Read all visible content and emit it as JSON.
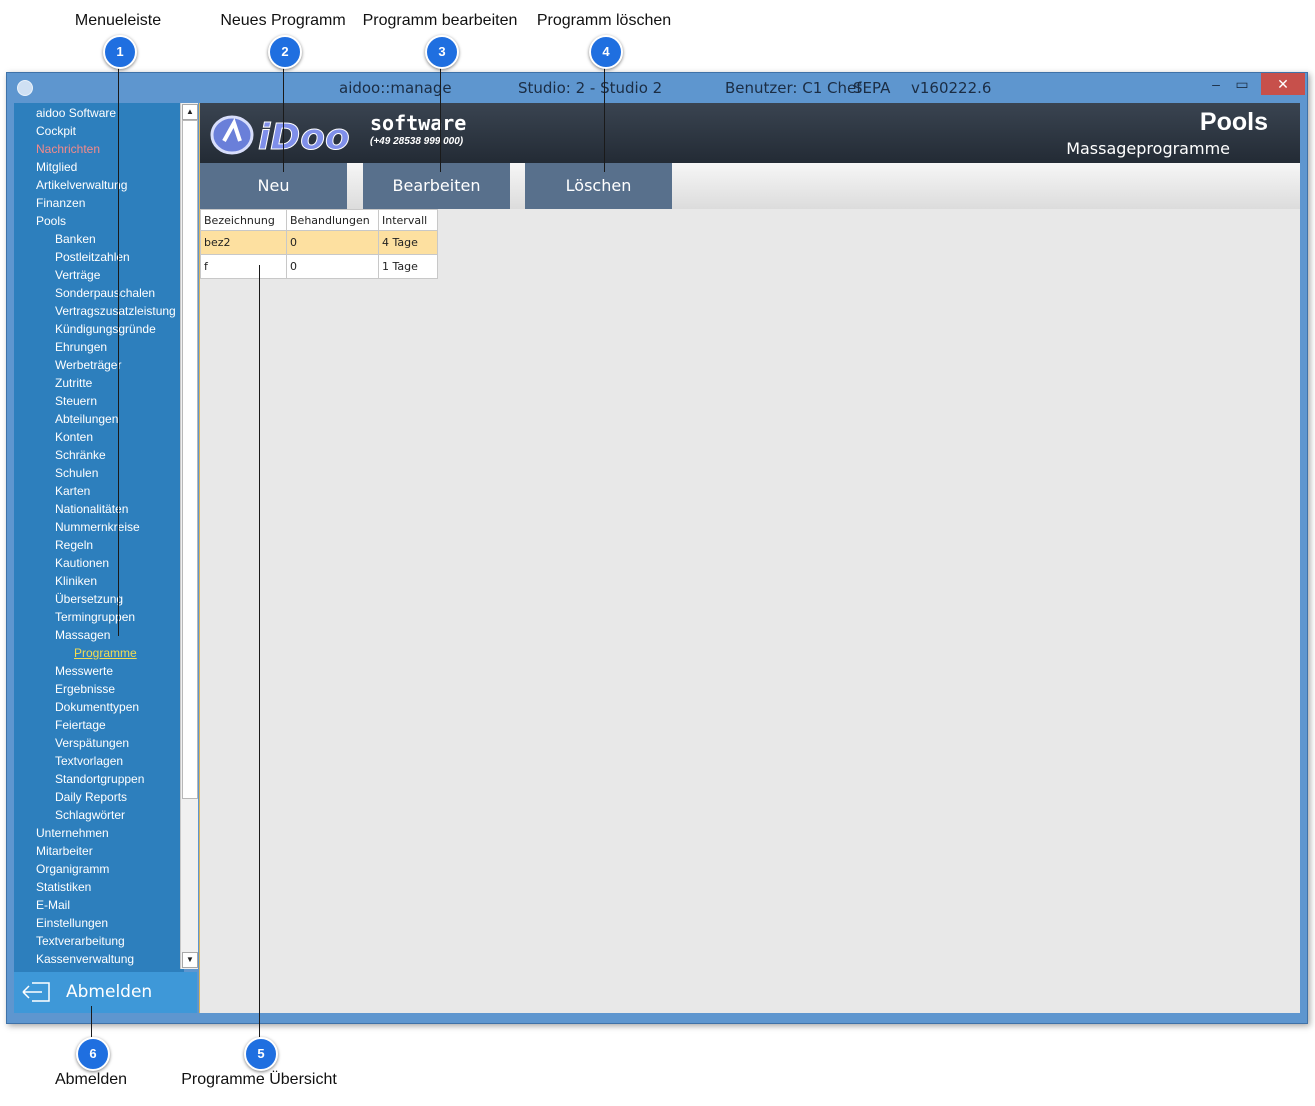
{
  "callouts": [
    {
      "num": "1",
      "label": "Menueleiste"
    },
    {
      "num": "2",
      "label": "Neues Programm"
    },
    {
      "num": "3",
      "label": "Programm bearbeiten"
    },
    {
      "num": "4",
      "label": "Programm löschen"
    },
    {
      "num": "5",
      "label": "Programme Übersicht"
    },
    {
      "num": "6",
      "label": "Abmelden"
    }
  ],
  "titlebar": {
    "app": "aidoo::manage",
    "studio": "Studio: 2 - Studio 2",
    "user": "Benutzer: C1 Chef",
    "sepa": "SEPA",
    "version": "v160222.6",
    "minimize": "–",
    "maximize": "▭",
    "close": "✕"
  },
  "menu": {
    "items": [
      {
        "label": "aidoo Software",
        "level": 0
      },
      {
        "label": "Cockpit",
        "level": 0
      },
      {
        "label": "Nachrichten",
        "level": 0,
        "state": "red"
      },
      {
        "label": "Mitglied",
        "level": 0
      },
      {
        "label": "Artikelverwaltung",
        "level": 0
      },
      {
        "label": "Finanzen",
        "level": 0
      },
      {
        "label": "Pools",
        "level": 0
      },
      {
        "label": "Banken",
        "level": 1
      },
      {
        "label": "Postleitzahlen",
        "level": 1
      },
      {
        "label": "Verträge",
        "level": 1
      },
      {
        "label": "Sonderpauschalen",
        "level": 1
      },
      {
        "label": "Vertragszusatzleistung",
        "level": 1
      },
      {
        "label": "Kündigungsgründe",
        "level": 1
      },
      {
        "label": "Ehrungen",
        "level": 1
      },
      {
        "label": "Werbeträger",
        "level": 1
      },
      {
        "label": "Zutritte",
        "level": 1
      },
      {
        "label": "Steuern",
        "level": 1
      },
      {
        "label": "Abteilungen",
        "level": 1
      },
      {
        "label": "Konten",
        "level": 1
      },
      {
        "label": "Schränke",
        "level": 1
      },
      {
        "label": "Schulen",
        "level": 1
      },
      {
        "label": "Karten",
        "level": 1
      },
      {
        "label": "Nationalitäten",
        "level": 1
      },
      {
        "label": "Nummernkreise",
        "level": 1
      },
      {
        "label": "Regeln",
        "level": 1
      },
      {
        "label": "Kautionen",
        "level": 1
      },
      {
        "label": "Kliniken",
        "level": 1
      },
      {
        "label": "Übersetzung",
        "level": 1
      },
      {
        "label": "Termingruppen",
        "level": 1
      },
      {
        "label": "Massagen",
        "level": 1
      },
      {
        "label": "Programme",
        "level": 2,
        "state": "yellow"
      },
      {
        "label": "Messwerte",
        "level": 1
      },
      {
        "label": "Ergebnisse",
        "level": 1
      },
      {
        "label": "Dokumenttypen",
        "level": 1
      },
      {
        "label": "Feiertage",
        "level": 1
      },
      {
        "label": "Verspätungen",
        "level": 1
      },
      {
        "label": "Textvorlagen",
        "level": 1
      },
      {
        "label": "Standortgruppen",
        "level": 1
      },
      {
        "label": "Daily Reports",
        "level": 1
      },
      {
        "label": "Schlagwörter",
        "level": 1
      },
      {
        "label": "Unternehmen",
        "level": 0
      },
      {
        "label": "Mitarbeiter",
        "level": 0
      },
      {
        "label": "Organigramm",
        "level": 0
      },
      {
        "label": "Statistiken",
        "level": 0
      },
      {
        "label": "E-Mail",
        "level": 0
      },
      {
        "label": "Einstellungen",
        "level": 0
      },
      {
        "label": "Textverarbeitung",
        "level": 0
      },
      {
        "label": "Kassenverwaltung",
        "level": 0
      }
    ],
    "scroll_up": "▲",
    "scroll_down": "▼"
  },
  "logout": {
    "label": "Abmelden",
    "icon": "logout-arrow-icon"
  },
  "header": {
    "logo_text": "iDoo",
    "logo_software": "software",
    "logo_phone": "(+49 28538 999 000)",
    "title": "Pools",
    "subtitle": "Massageprogramme"
  },
  "toolbar": {
    "new": "Neu",
    "edit": "Bearbeiten",
    "delete": "Löschen"
  },
  "table": {
    "columns": [
      "Bezeichnung",
      "Behandlungen",
      "Intervall"
    ],
    "rows": [
      [
        "bez2",
        "0",
        "4 Tage"
      ],
      [
        "f",
        "0",
        "1 Tage"
      ]
    ]
  },
  "colors": {
    "window_frame": "#5e96cf",
    "sidebar_bg": "#2d7fbd",
    "accent_button": "#58708c",
    "badge": "#1f6fe0",
    "selected_row": "#fde0a0"
  }
}
